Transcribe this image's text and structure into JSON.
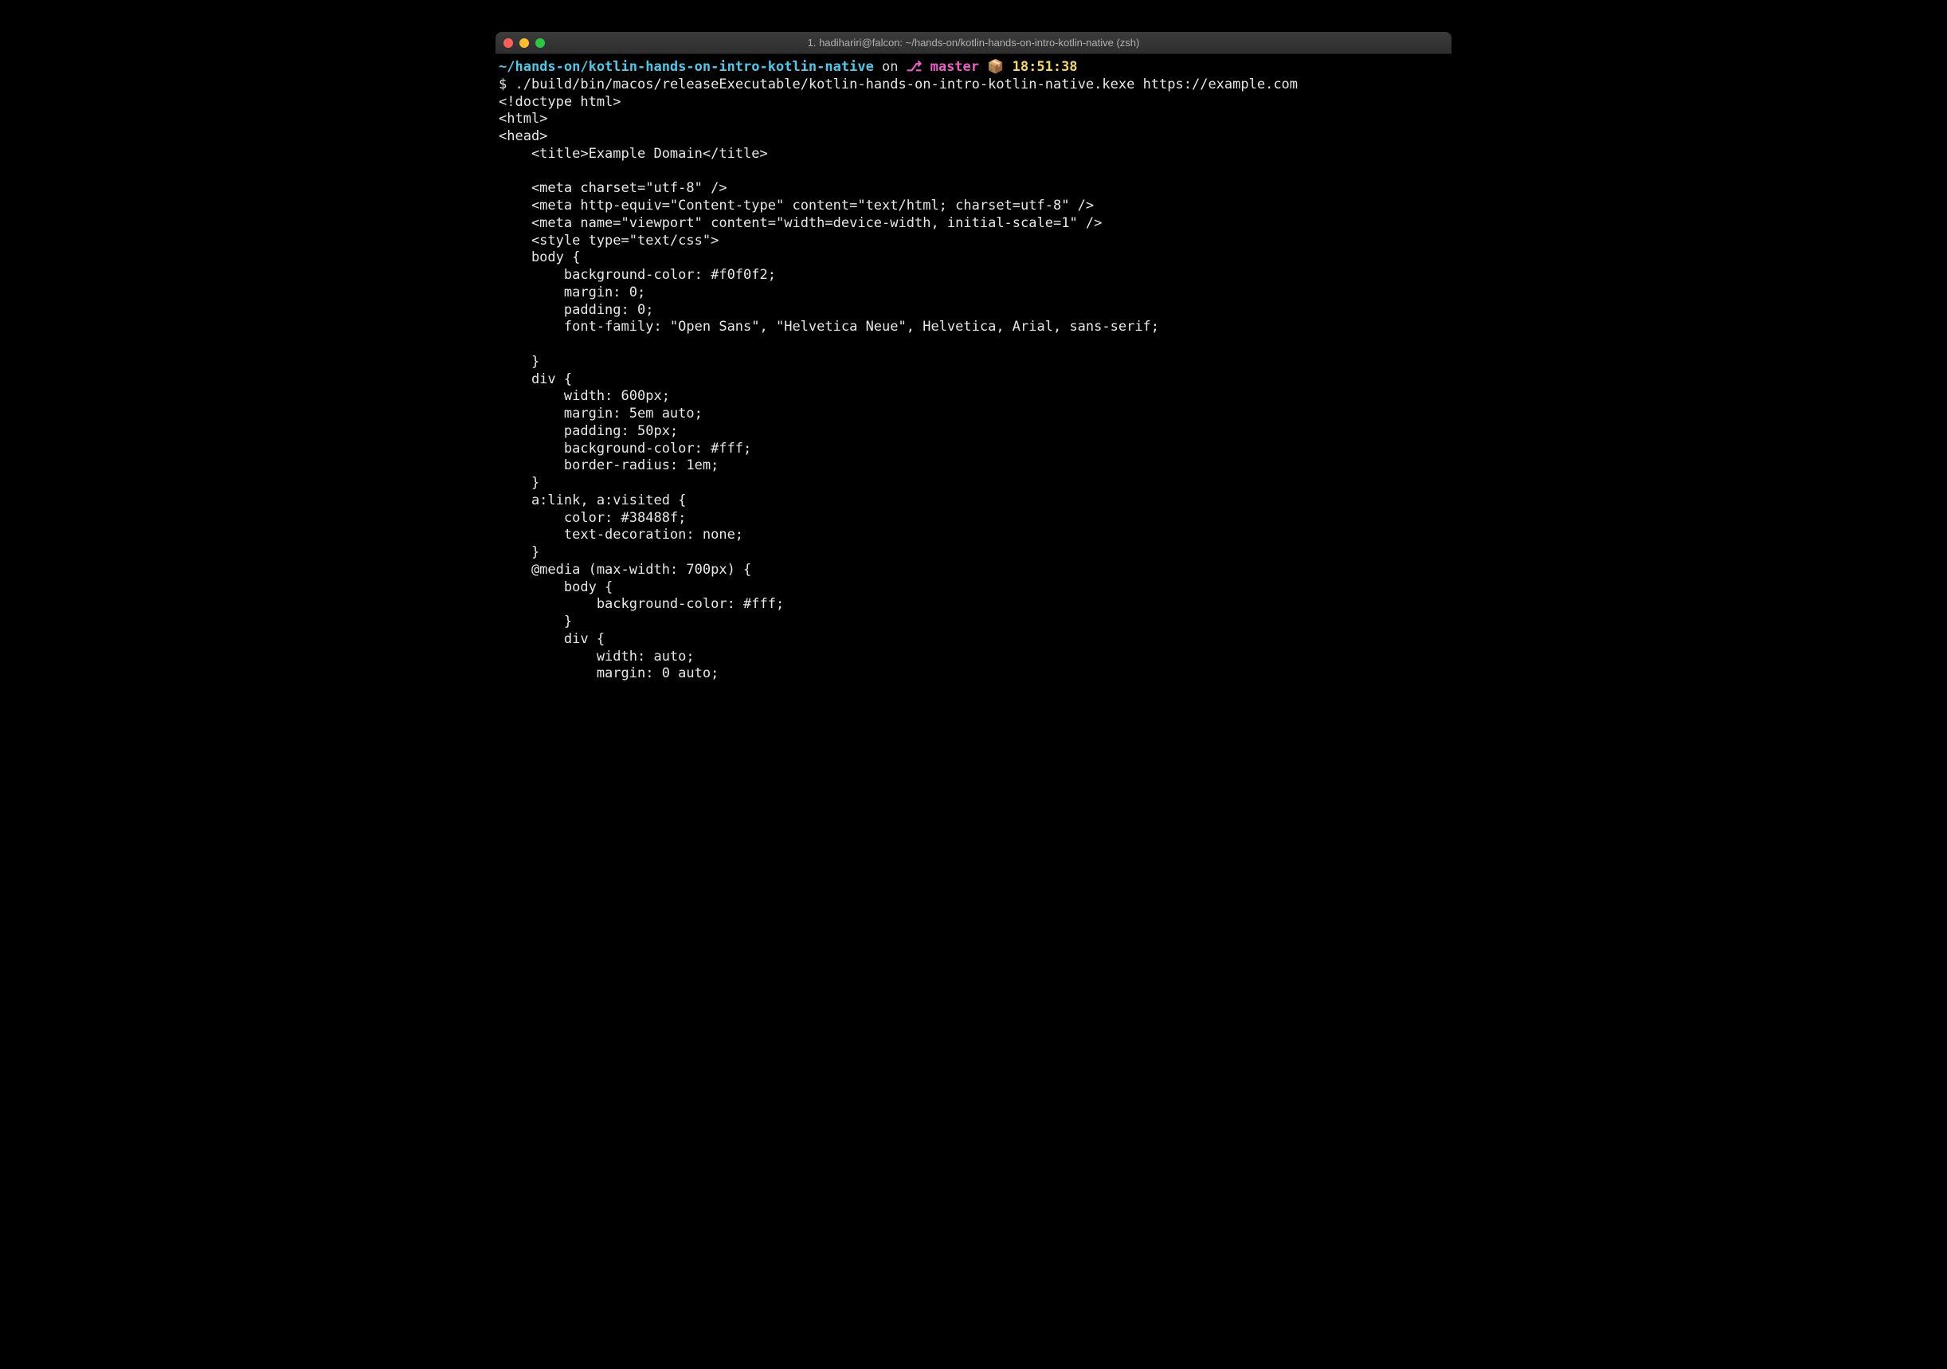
{
  "window": {
    "title": "1. hadihariri@falcon: ~/hands-on/kotlin-hands-on-intro-kotlin-native (zsh)"
  },
  "prompt": {
    "path": "~/hands-on/kotlin-hands-on-intro-kotlin-native",
    "on": " on ",
    "branch_icon": "⎇",
    "branch": " master",
    "pkg_icon": " 📦 ",
    "time": "18:51:38"
  },
  "command": {
    "prompt": "$ ",
    "text": "./build/bin/macos/releaseExecutable/kotlin-hands-on-intro-kotlin-native.kexe https://example.com"
  },
  "output": {
    "lines": [
      "<!doctype html>",
      "<html>",
      "<head>",
      "    <title>Example Domain</title>",
      "",
      "    <meta charset=\"utf-8\" />",
      "    <meta http-equiv=\"Content-type\" content=\"text/html; charset=utf-8\" />",
      "    <meta name=\"viewport\" content=\"width=device-width, initial-scale=1\" />",
      "    <style type=\"text/css\">",
      "    body {",
      "        background-color: #f0f0f2;",
      "        margin: 0;",
      "        padding: 0;",
      "        font-family: \"Open Sans\", \"Helvetica Neue\", Helvetica, Arial, sans-serif;",
      "",
      "    }",
      "    div {",
      "        width: 600px;",
      "        margin: 5em auto;",
      "        padding: 50px;",
      "        background-color: #fff;",
      "        border-radius: 1em;",
      "    }",
      "    a:link, a:visited {",
      "        color: #38488f;",
      "        text-decoration: none;",
      "    }",
      "    @media (max-width: 700px) {",
      "        body {",
      "            background-color: #fff;",
      "        }",
      "        div {",
      "            width: auto;",
      "            margin: 0 auto;"
    ]
  }
}
